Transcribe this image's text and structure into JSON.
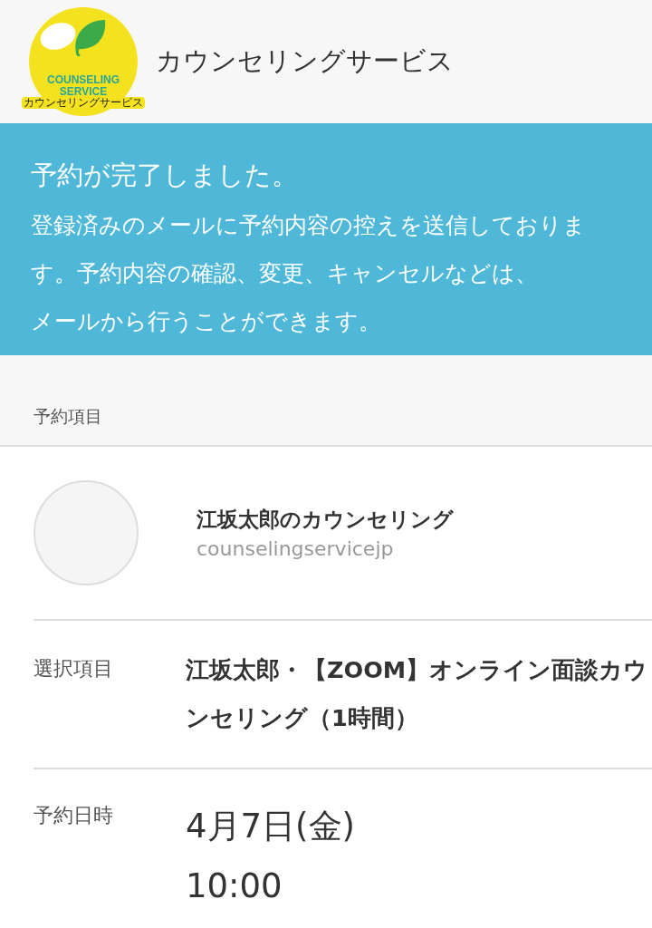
{
  "header": {
    "logo": {
      "line_1": "COUNSELING",
      "line_2": "SERVICE",
      "line_3": "カウンセリングサービス"
    },
    "title": "カウンセリングサービス"
  },
  "notice": {
    "heading": "予約が完了しました。",
    "message": [
      "登録済みのメールに予約内容の控えを送信しております。予約内容の確認、変更、キャンセルなどは、",
      "メールから行うことができます。"
    ]
  },
  "section": {
    "label": "予約項目"
  },
  "provider": {
    "name": "江坂太郎のカウンセリング",
    "account": "counselingservicejp"
  },
  "details": [
    {
      "kind": "text",
      "label": "選択項目",
      "value": "江坂太郎・【ZOOM】オンライン面談カウンセリング（1時間）"
    },
    {
      "kind": "datetime",
      "label": "予約日時",
      "date": "4月7日(金)",
      "time": "10:00"
    }
  ]
}
